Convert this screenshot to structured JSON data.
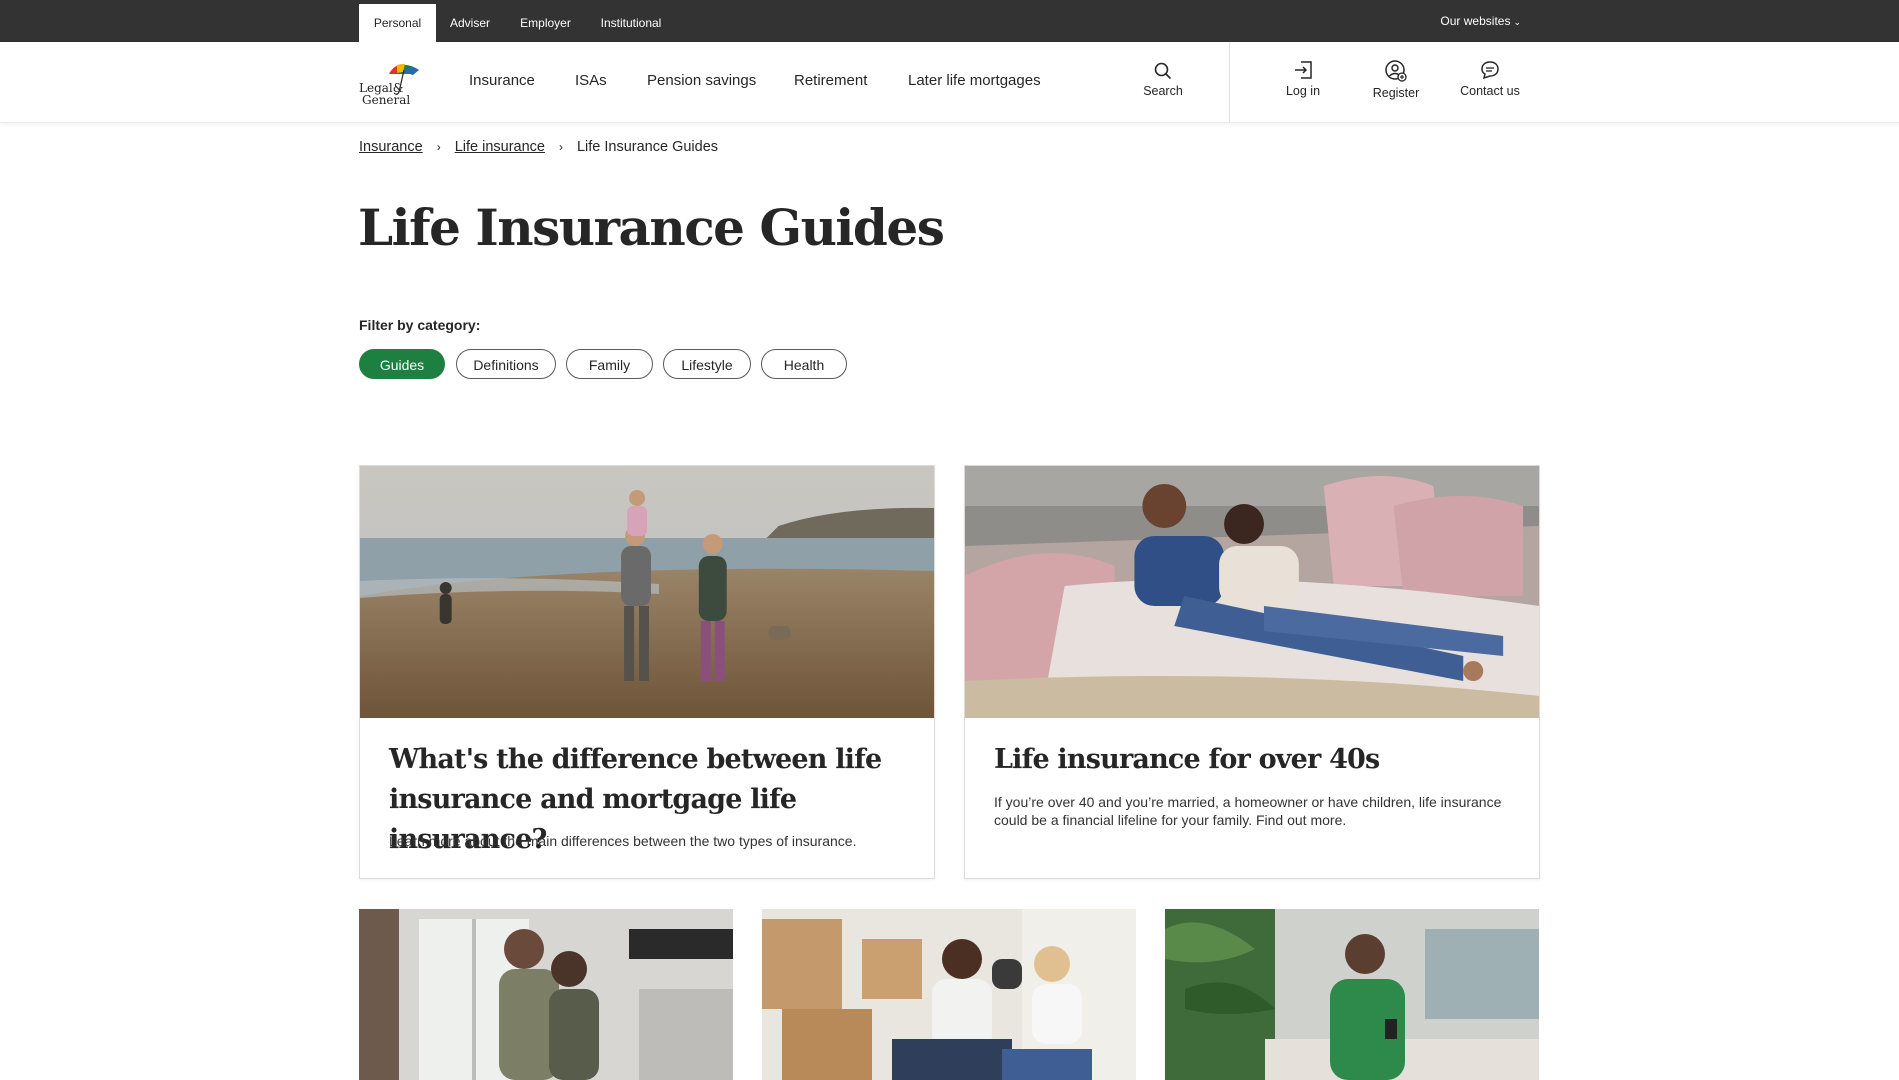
{
  "utility_nav": {
    "tabs": [
      {
        "label": "Personal"
      },
      {
        "label": "Adviser"
      },
      {
        "label": "Employer"
      },
      {
        "label": "Institutional"
      }
    ],
    "our_websites": "Our websites"
  },
  "main_nav": {
    "logo_text": "Legal & General",
    "links": [
      {
        "label": "Insurance"
      },
      {
        "label": "ISAs"
      },
      {
        "label": "Pension savings"
      },
      {
        "label": "Retirement"
      },
      {
        "label": "Later life mortgages"
      }
    ],
    "tools": {
      "search": "Search",
      "login": "Log in",
      "register": "Register",
      "contact": "Contact us"
    }
  },
  "breadcrumb": {
    "items": [
      {
        "label": "Insurance"
      },
      {
        "label": "Life insurance"
      },
      {
        "label": "Life Insurance Guides"
      }
    ]
  },
  "page": {
    "title": "Life Insurance Guides",
    "filter_label": "Filter by category:"
  },
  "filters": [
    {
      "label": "Guides",
      "active": true
    },
    {
      "label": "Definitions"
    },
    {
      "label": "Family"
    },
    {
      "label": "Lifestyle"
    },
    {
      "label": "Health"
    }
  ],
  "cards": [
    {
      "title": "What's the difference between life in­surance and mortgage life insurance?",
      "description": "Learn more about the main differences between the two types of insurance."
    },
    {
      "title": "Life insurance for over 40s",
      "description": "If you’re over 40 and you’re married, a homeowner or have children, life insurance could be a financial lifeline for your family. Find out more."
    }
  ],
  "colors": {
    "utility_bar": "#333333",
    "accent_green": "#1e8040",
    "text": "#262626"
  }
}
